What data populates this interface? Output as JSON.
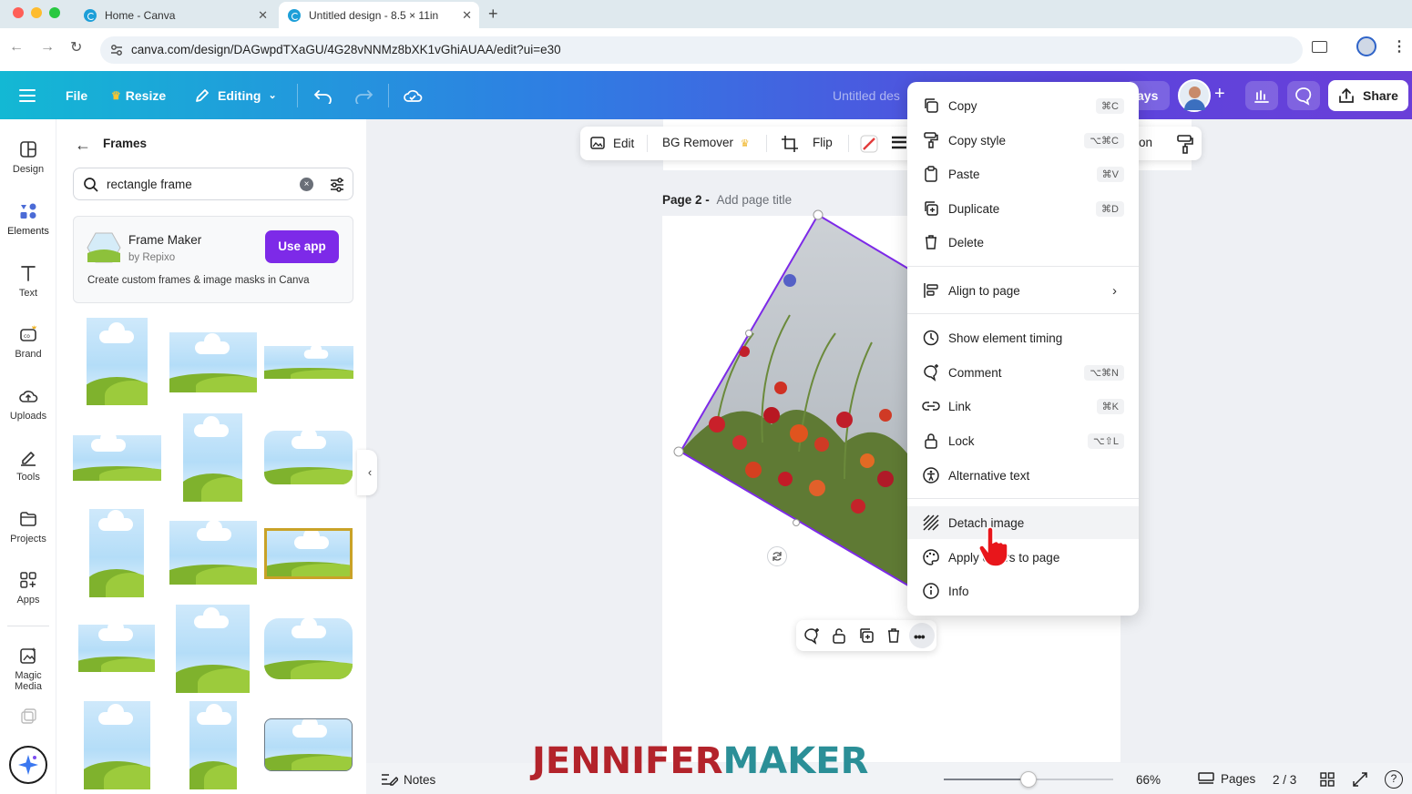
{
  "browser": {
    "tabs": [
      {
        "title": "Home - Canva",
        "active": false
      },
      {
        "title": "Untitled design - 8.5 × 11in",
        "active": true
      }
    ],
    "url": "canva.com/design/DAGwpdTXaGU/4G28vNNMz8bXK1vGhiAUAA/edit?ui=e30"
  },
  "header": {
    "file": "File",
    "resize": "Resize",
    "editing": "Editing",
    "doc_title": "Untitled des",
    "partial_button": "ays",
    "share": "Share"
  },
  "rail": [
    {
      "label": "Design",
      "icon": "design-icon"
    },
    {
      "label": "Elements",
      "icon": "elements-icon",
      "active": true
    },
    {
      "label": "Text",
      "icon": "text-icon"
    },
    {
      "label": "Brand",
      "icon": "brand-icon"
    },
    {
      "label": "Uploads",
      "icon": "uploads-icon"
    },
    {
      "label": "Tools",
      "icon": "tools-icon"
    },
    {
      "label": "Projects",
      "icon": "projects-icon"
    },
    {
      "label": "Apps",
      "icon": "apps-icon"
    },
    {
      "label": "Magic Media",
      "icon": "magic-media-icon"
    }
  ],
  "panel": {
    "title": "Frames",
    "search_value": "rectangle frame",
    "app_card": {
      "name": "Frame Maker",
      "by": "by Repixo",
      "button": "Use app",
      "description": "Create custom frames & image masks in Canva"
    }
  },
  "toolbar": {
    "edit": "Edit",
    "bg_remover": "BG Remover",
    "flip": "Flip",
    "partial": "on"
  },
  "page": {
    "label": "Page 2 -",
    "title_placeholder": "Add page title"
  },
  "context_menu": [
    {
      "label": "Copy",
      "shortcut": "⌘C",
      "icon": "copy-icon"
    },
    {
      "label": "Copy style",
      "shortcut": "⌥⌘C",
      "icon": "paint-roller-icon"
    },
    {
      "label": "Paste",
      "shortcut": "⌘V",
      "icon": "clipboard-icon"
    },
    {
      "label": "Duplicate",
      "shortcut": "⌘D",
      "icon": "duplicate-icon"
    },
    {
      "label": "Delete",
      "shortcut": "",
      "icon": "trash-icon"
    },
    {
      "label": "Align to page",
      "shortcut": "",
      "icon": "align-icon",
      "submenu": true
    },
    {
      "label": "Show element timing",
      "shortcut": "",
      "icon": "clock-icon"
    },
    {
      "label": "Comment",
      "shortcut": "⌥⌘N",
      "icon": "comment-icon"
    },
    {
      "label": "Link",
      "shortcut": "⌘K",
      "icon": "link-icon"
    },
    {
      "label": "Lock",
      "shortcut": "⌥⇧L",
      "icon": "lock-icon"
    },
    {
      "label": "Alternative text",
      "shortcut": "",
      "icon": "accessibility-icon"
    },
    {
      "label": "Detach image",
      "shortcut": "",
      "icon": "hatch-icon",
      "highlighted": true
    },
    {
      "label": "Apply colors to page",
      "shortcut": "",
      "icon": "palette-icon"
    },
    {
      "label": "Info",
      "shortcut": "",
      "icon": "info-icon"
    }
  ],
  "footer": {
    "notes": "Notes",
    "zoom": "66%",
    "pages": "Pages",
    "page_count": "2 / 3",
    "help": "?",
    "zoom_level": 0.5
  },
  "watermark": {
    "part1": "JENNIFER",
    "part2": "MAKER"
  },
  "colors": {
    "accent_purple": "#7d2ae8",
    "watermark_red": "#b3232b",
    "watermark_teal": "#2b8f97"
  }
}
